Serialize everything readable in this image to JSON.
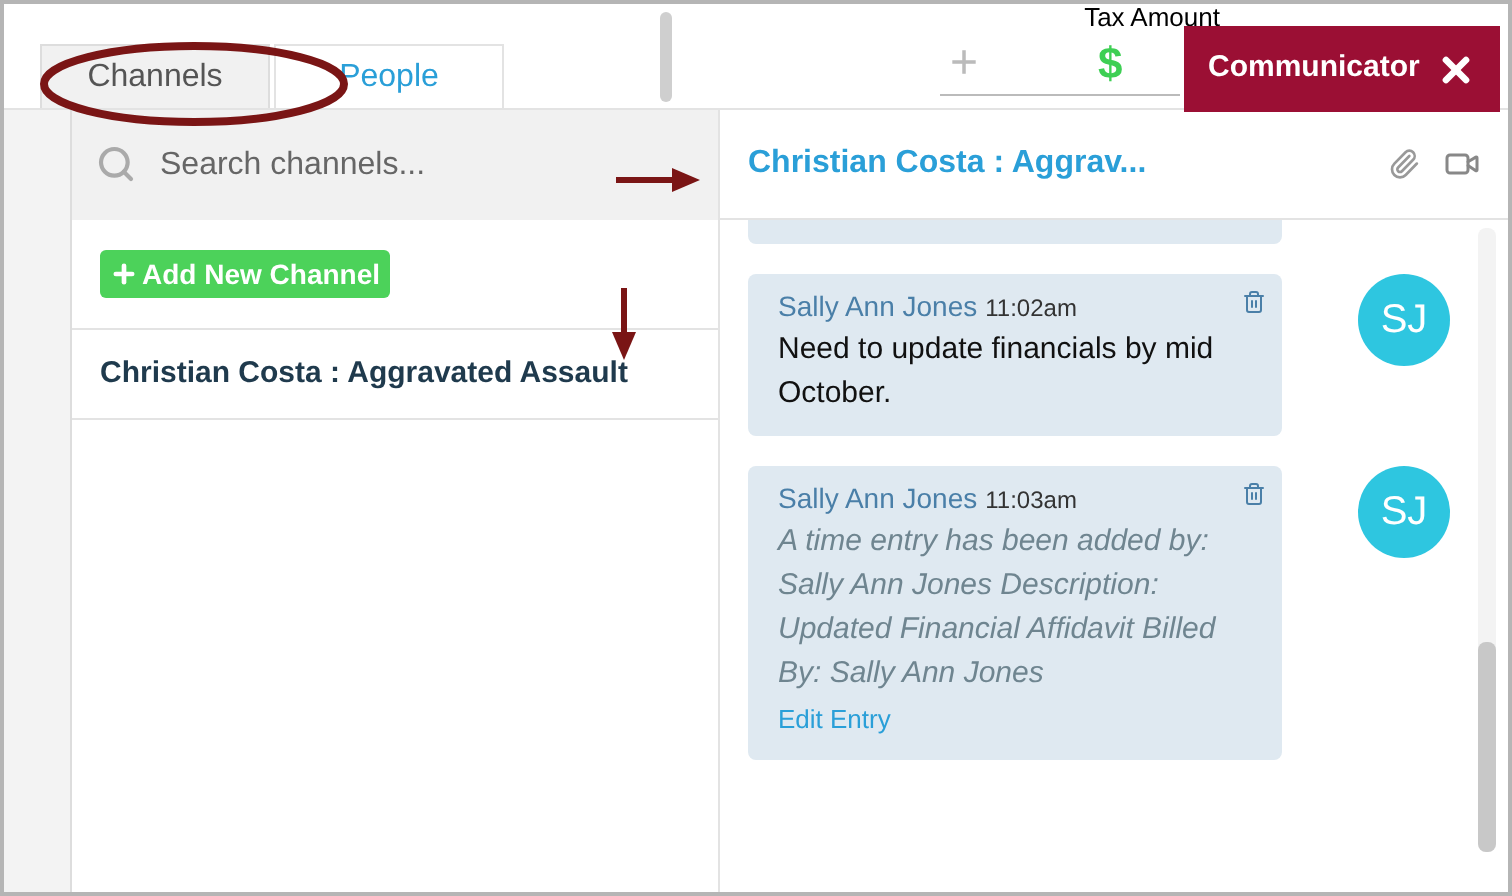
{
  "tabs": [
    {
      "label": "Channels",
      "selected": true
    },
    {
      "label": "People",
      "selected": false
    }
  ],
  "background": {
    "column_label": "Tax Amount",
    "add_symbol": "+",
    "currency_symbol": "$"
  },
  "communicator": {
    "title": "Communicator"
  },
  "search": {
    "placeholder": "Search channels..."
  },
  "add_channel_button": "Add New Channel",
  "channels": [
    {
      "name": "Christian Costa : Aggravated Assault"
    }
  ],
  "conversation": {
    "title": "Christian Costa : Aggrav...",
    "messages": [
      {
        "kind": "text",
        "author": "Sally Ann Jones",
        "time": "11:02am",
        "body": "Need to update financials by mid October.",
        "initials": "SJ"
      },
      {
        "kind": "time_entry",
        "author": "Sally Ann Jones",
        "time": "11:03am",
        "body": "A time entry has been added by: Sally Ann Jones Description: Updated Financial Affidavit Billed By: Sally Ann Jones",
        "action": "Edit Entry",
        "initials": "SJ"
      }
    ]
  }
}
